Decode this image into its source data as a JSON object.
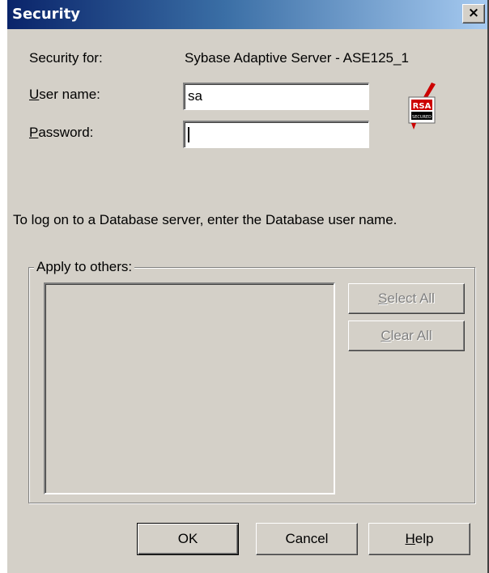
{
  "window": {
    "title": "Security",
    "close_glyph": "×"
  },
  "form": {
    "security_for_label": "Security for:",
    "security_for_value": "Sybase Adaptive Server - ASE125_1",
    "user_name_label_mnemonic": "U",
    "user_name_label_rest": "ser name:",
    "user_name_value": "sa",
    "password_label_mnemonic": "P",
    "password_label_rest": "assword:",
    "password_value": ""
  },
  "badge": {
    "icon": "rsa-secured-icon",
    "line1": "RSA",
    "line2": "SECURED"
  },
  "hint": "To log on to a Database server, enter the Database user name.",
  "apply_group": {
    "label": "Apply to others:",
    "items": [],
    "select_all_mnemonic": "S",
    "select_all_rest": "elect All",
    "clear_all_mnemonic": "C",
    "clear_all_rest": "lear All"
  },
  "footer": {
    "ok": "OK",
    "cancel": "Cancel",
    "help_mnemonic": "H",
    "help_rest": "elp"
  },
  "colors": {
    "dialog_face": "#d4d0c8",
    "title_start": "#0a246a",
    "title_end": "#a6caf0",
    "disabled_text": "#808080",
    "badge_red": "#cc0000"
  }
}
